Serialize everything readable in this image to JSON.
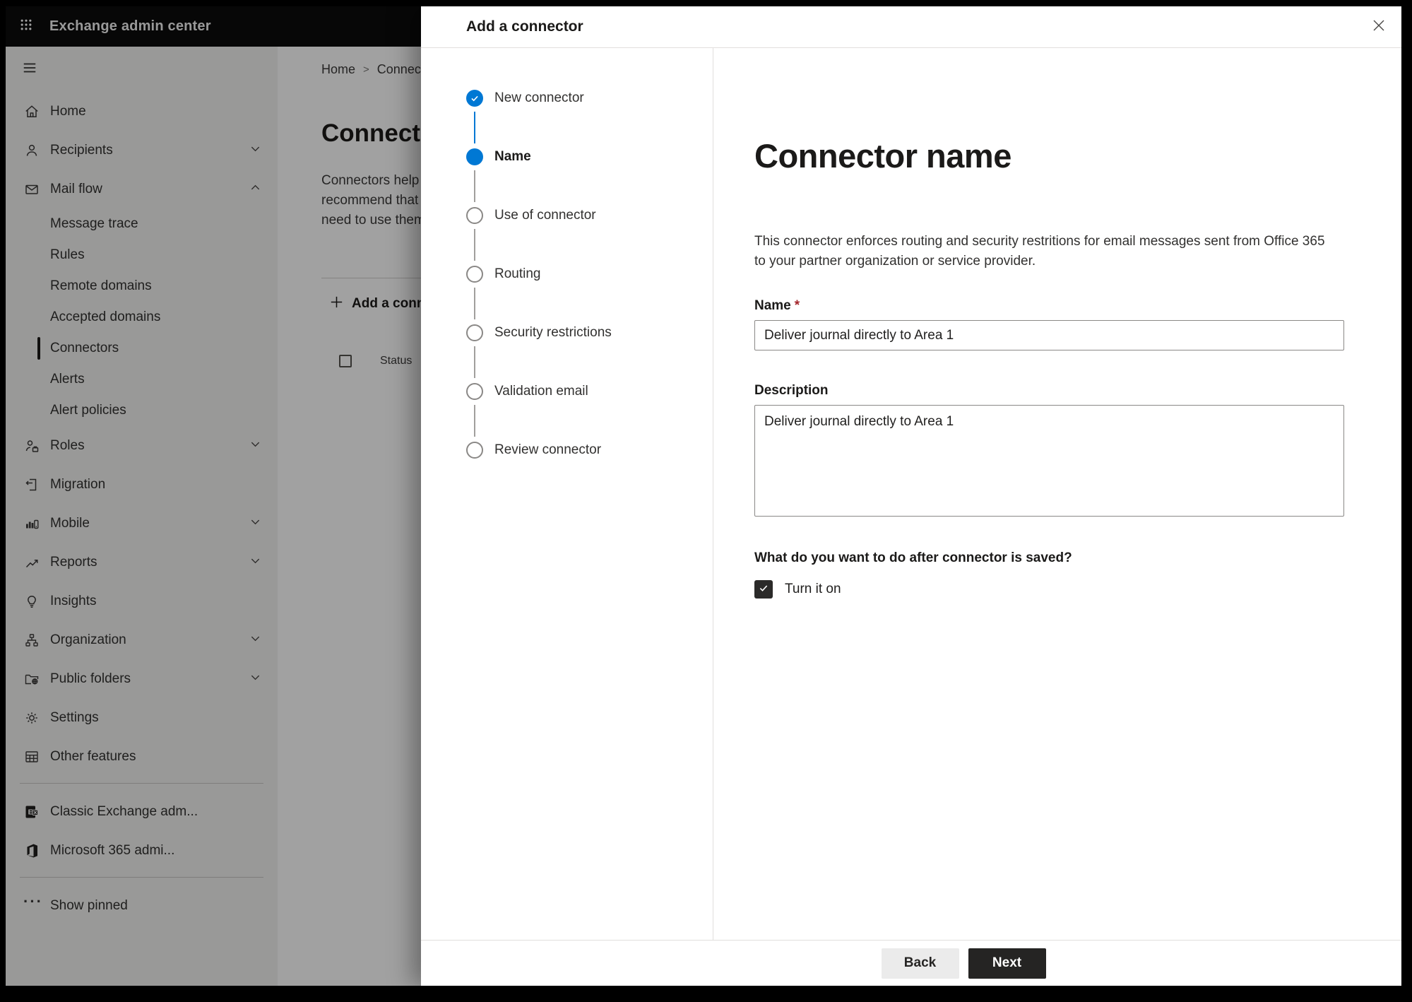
{
  "topbar": {
    "title": "Exchange admin center"
  },
  "sidebar": {
    "items": [
      {
        "label": "Home",
        "icon": "home-icon"
      },
      {
        "label": "Recipients",
        "icon": "person-icon",
        "chevron": "down"
      },
      {
        "label": "Mail flow",
        "icon": "mail-icon",
        "chevron": "up",
        "expanded": true
      },
      {
        "label": "Message trace",
        "sub": true
      },
      {
        "label": "Rules",
        "sub": true
      },
      {
        "label": "Remote domains",
        "sub": true
      },
      {
        "label": "Accepted domains",
        "sub": true
      },
      {
        "label": "Connectors",
        "sub": true,
        "selected": true
      },
      {
        "label": "Alerts",
        "sub": true
      },
      {
        "label": "Alert policies",
        "sub": true
      },
      {
        "label": "Roles",
        "icon": "roles-icon",
        "chevron": "down"
      },
      {
        "label": "Migration",
        "icon": "migration-icon"
      },
      {
        "label": "Mobile",
        "icon": "mobile-icon",
        "chevron": "down"
      },
      {
        "label": "Reports",
        "icon": "reports-icon",
        "chevron": "down"
      },
      {
        "label": "Insights",
        "icon": "insights-icon"
      },
      {
        "label": "Organization",
        "icon": "organization-icon",
        "chevron": "down"
      },
      {
        "label": "Public folders",
        "icon": "public-folders-icon",
        "chevron": "down"
      },
      {
        "label": "Settings",
        "icon": "settings-icon"
      },
      {
        "label": "Other features",
        "icon": "other-features-icon"
      },
      {
        "label": "Classic Exchange adm...",
        "icon": "classic-exchange-icon"
      },
      {
        "label": "Microsoft 365 admi...",
        "icon": "microsoft-365-icon"
      },
      {
        "label": "Show pinned",
        "icon": "ellipsis-icon"
      }
    ]
  },
  "page": {
    "breadcrumb": {
      "home": "Home",
      "separator": ">",
      "current": "Connectors"
    },
    "title": "Connectors",
    "intro_lines": {
      "line1": "Connectors help route",
      "line2": "recommend that you",
      "line3": "need to use them."
    },
    "add_button": "Add a connector",
    "table": {
      "status_header": "Status"
    }
  },
  "dialog": {
    "title": "Add a connector",
    "steps": [
      {
        "label": "New connector",
        "state": "completed"
      },
      {
        "label": "Name",
        "state": "current"
      },
      {
        "label": "Use of connector",
        "state": "upcoming"
      },
      {
        "label": "Routing",
        "state": "upcoming"
      },
      {
        "label": "Security restrictions",
        "state": "upcoming"
      },
      {
        "label": "Validation email",
        "state": "upcoming"
      },
      {
        "label": "Review connector",
        "state": "upcoming"
      }
    ],
    "content": {
      "heading": "Connector name",
      "intro_line1": "This connector enforces routing and security restritions for email messages sent from Office 365",
      "intro_line2": "to your partner organization or service provider.",
      "name_label": "Name",
      "required_mark": "*",
      "name_value": "Deliver journal directly to Area 1",
      "description_label": "Description",
      "description_value": "Deliver journal directly to Area 1",
      "question": "What do you want to do after connector is saved?",
      "checkbox_label": "Turn it on",
      "checkbox_checked": true
    },
    "footer": {
      "back": "Back",
      "next": "Next"
    }
  },
  "colors": {
    "accent_blue": "#0078d4",
    "primary_button": "#252423",
    "checkbox_fill": "#2b2a29",
    "required_red": "#a4262c",
    "topbar_bg": "#0c0c0c"
  }
}
